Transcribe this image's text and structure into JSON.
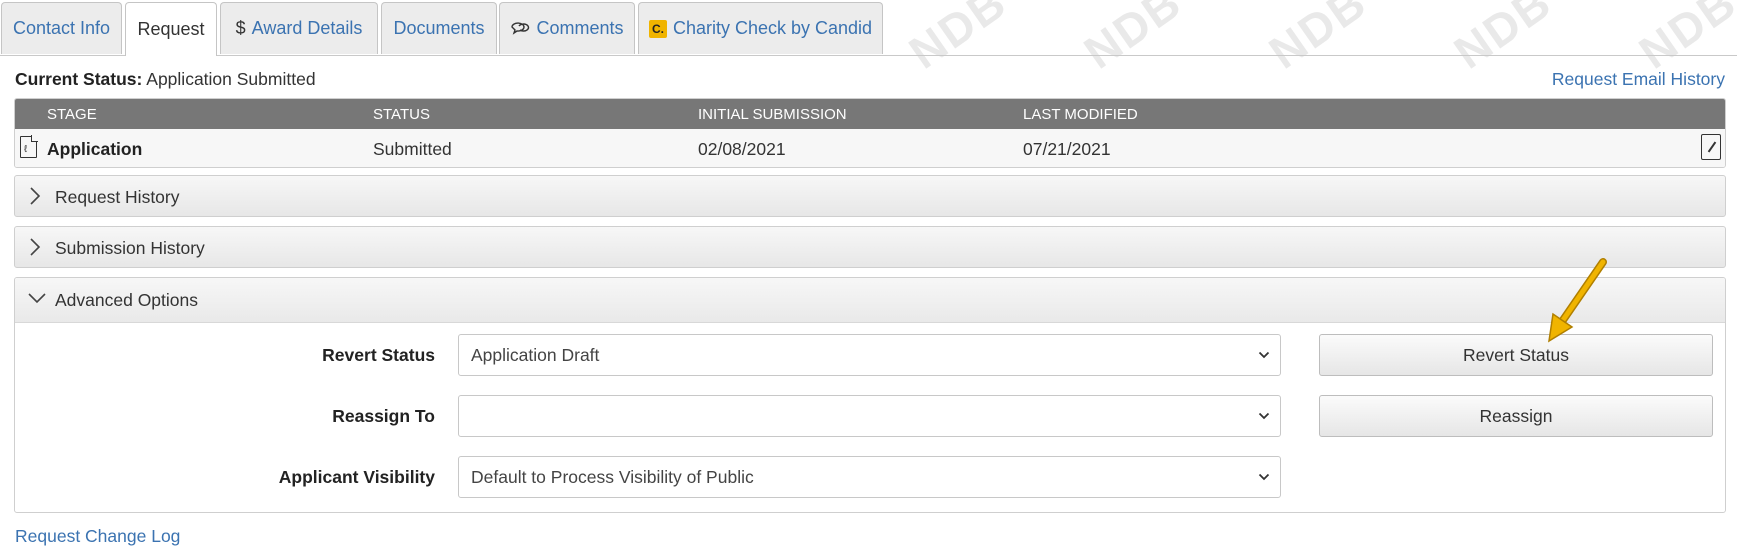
{
  "watermark": "NDB",
  "tabs": [
    {
      "label": "Contact Info",
      "icon": "",
      "active": false
    },
    {
      "label": "Request",
      "icon": "",
      "active": true
    },
    {
      "label": "Award Details",
      "icon": "dollar-icon",
      "active": false
    },
    {
      "label": "Documents",
      "icon": "",
      "active": false
    },
    {
      "label": "Comments",
      "icon": "comments-icon",
      "active": false
    },
    {
      "label": "Charity Check by Candid",
      "icon": "candid-icon",
      "active": false
    }
  ],
  "candid_icon_text": "C.",
  "current_status": {
    "label": "Current Status:",
    "value": "Application Submitted"
  },
  "request_email_history": "Request Email History",
  "stage_table": {
    "headers": [
      "STAGE",
      "STATUS",
      "INITIAL SUBMISSION",
      "LAST MODIFIED"
    ],
    "rows": [
      {
        "stage": "Application",
        "status": "Submitted",
        "initial_submission": "02/08/2021",
        "last_modified": "07/21/2021"
      }
    ]
  },
  "panels": {
    "request_history": "Request History",
    "submission_history": "Submission History",
    "advanced_options": "Advanced Options"
  },
  "advanced": {
    "revert_status_label": "Revert Status",
    "revert_status_value": "Application Draft",
    "revert_status_button": "Revert Status",
    "reassign_label": "Reassign To",
    "reassign_value": "",
    "reassign_button": "Reassign",
    "visibility_label": "Applicant Visibility",
    "visibility_value": "Default to Process Visibility of Public"
  },
  "request_change_log": "Request Change Log",
  "colors": {
    "link": "#3b73b1",
    "table_header": "#777777",
    "arrow": "#f0b400"
  }
}
